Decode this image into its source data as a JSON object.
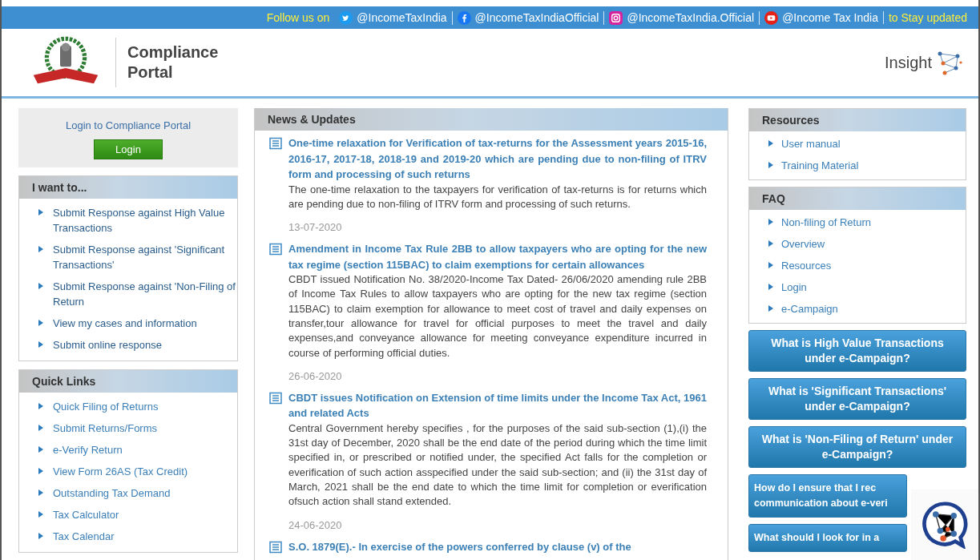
{
  "social_bar": {
    "lead": "Follow us on",
    "accounts": [
      {
        "kind": "twitter",
        "handle": "@IncomeTaxIndia"
      },
      {
        "kind": "facebook",
        "handle": "@IncomeTaxIndiaOfficial"
      },
      {
        "kind": "instagram",
        "handle": "@IncomeTaxIndia.Official"
      },
      {
        "kind": "youtube",
        "handle": "@Income Tax India"
      }
    ],
    "tail": "to Stay updated"
  },
  "header": {
    "title": "Compliance Portal",
    "brand": "Insight"
  },
  "login_box": {
    "prompt": "Login to Compliance Portal",
    "button": "Login"
  },
  "i_want_to": {
    "title": "I want to...",
    "items": [
      "Submit Response against High Value Transactions",
      "Submit Response against 'Significant Transactions'",
      "Submit Response against 'Non-Filing of Return",
      "View my cases and information",
      "Submit online response"
    ]
  },
  "quick_links": {
    "title": "Quick Links",
    "items": [
      "Quick Filing of Returns",
      "Submit Returns/Forms",
      "e-Verify Return",
      "View Form 26AS (Tax Credit)",
      "Outstanding Tax Demand",
      "Tax Calculator",
      "Tax Calendar"
    ]
  },
  "news": {
    "title": "News & Updates",
    "items": [
      {
        "title": "One-time relaxation for Verification of tax-returns for the Assessment years 2015-16, 2016-17, 2017-18, 2018-19 and 2019-20 which are pending due to non-filing of ITRV form and processing of such returns",
        "body": "The one-time relaxation to the taxpayers for verification of tax-returns is for returns which are pending due to non-filing of ITRV form and processing of such returns.",
        "date": "13-07-2020"
      },
      {
        "title": "Amendment in Income Tax Rule 2BB to allow taxpayers who are opting for the new tax regime (section 115BAC) to claim exemptions for certain allowances",
        "body": "CBDT issued Notification No. 38/2020-Income Tax Dated- 26/06/2020 amending rule 2BB of Income Tax Rules to allow taxpayers who are opting for the new tax regime (section 115BAC) to claim exemption for allowance to meet cost of travel and daily expenses on transfer,tour allowance for travel for official purposes to meet the travel and daily expenses,and conveyance allowance for meeting conveyance expenditure incurred in course of performing official duties.",
        "date": "26-06-2020"
      },
      {
        "title": "CBDT issues Notification on Extension of time limits under the Income Tax Act, 1961 and related Acts",
        "body": "Central Government hereby specifies , for the purposes of the said sub-section (1),(i) the 31st day of December, 2020 shall be the end date of the period during which the time limit specified in, or prescribed or notified under, the specified Act falls for the completion or everification of such action asspecified under the said sub-section; and (ii) the 31st day of March, 2021 shall be the end date to which the time limit for completion or everification ofsuch action shall stand extended.",
        "date": "24-06-2020"
      },
      {
        "title": "S.O. 1879(E).- In exercise of the powers conferred by clause (v) of the"
      }
    ]
  },
  "resources": {
    "title": "Resources",
    "items": [
      "User manual",
      "Training Material"
    ]
  },
  "faq": {
    "title": "FAQ",
    "items": [
      "Non-filing of Return",
      "Overview",
      "Resources",
      "Login",
      "e-Campaign"
    ]
  },
  "faq_buttons": [
    "What is High Value Transactions under e-Campaign?",
    "What is 'Significant Transactions' under e-Campaign?",
    "What is 'Non-Filing of Return' under e-Campaign?",
    "How do I ensure that I rec communication about e-veri",
    "What should I look for in a"
  ]
}
